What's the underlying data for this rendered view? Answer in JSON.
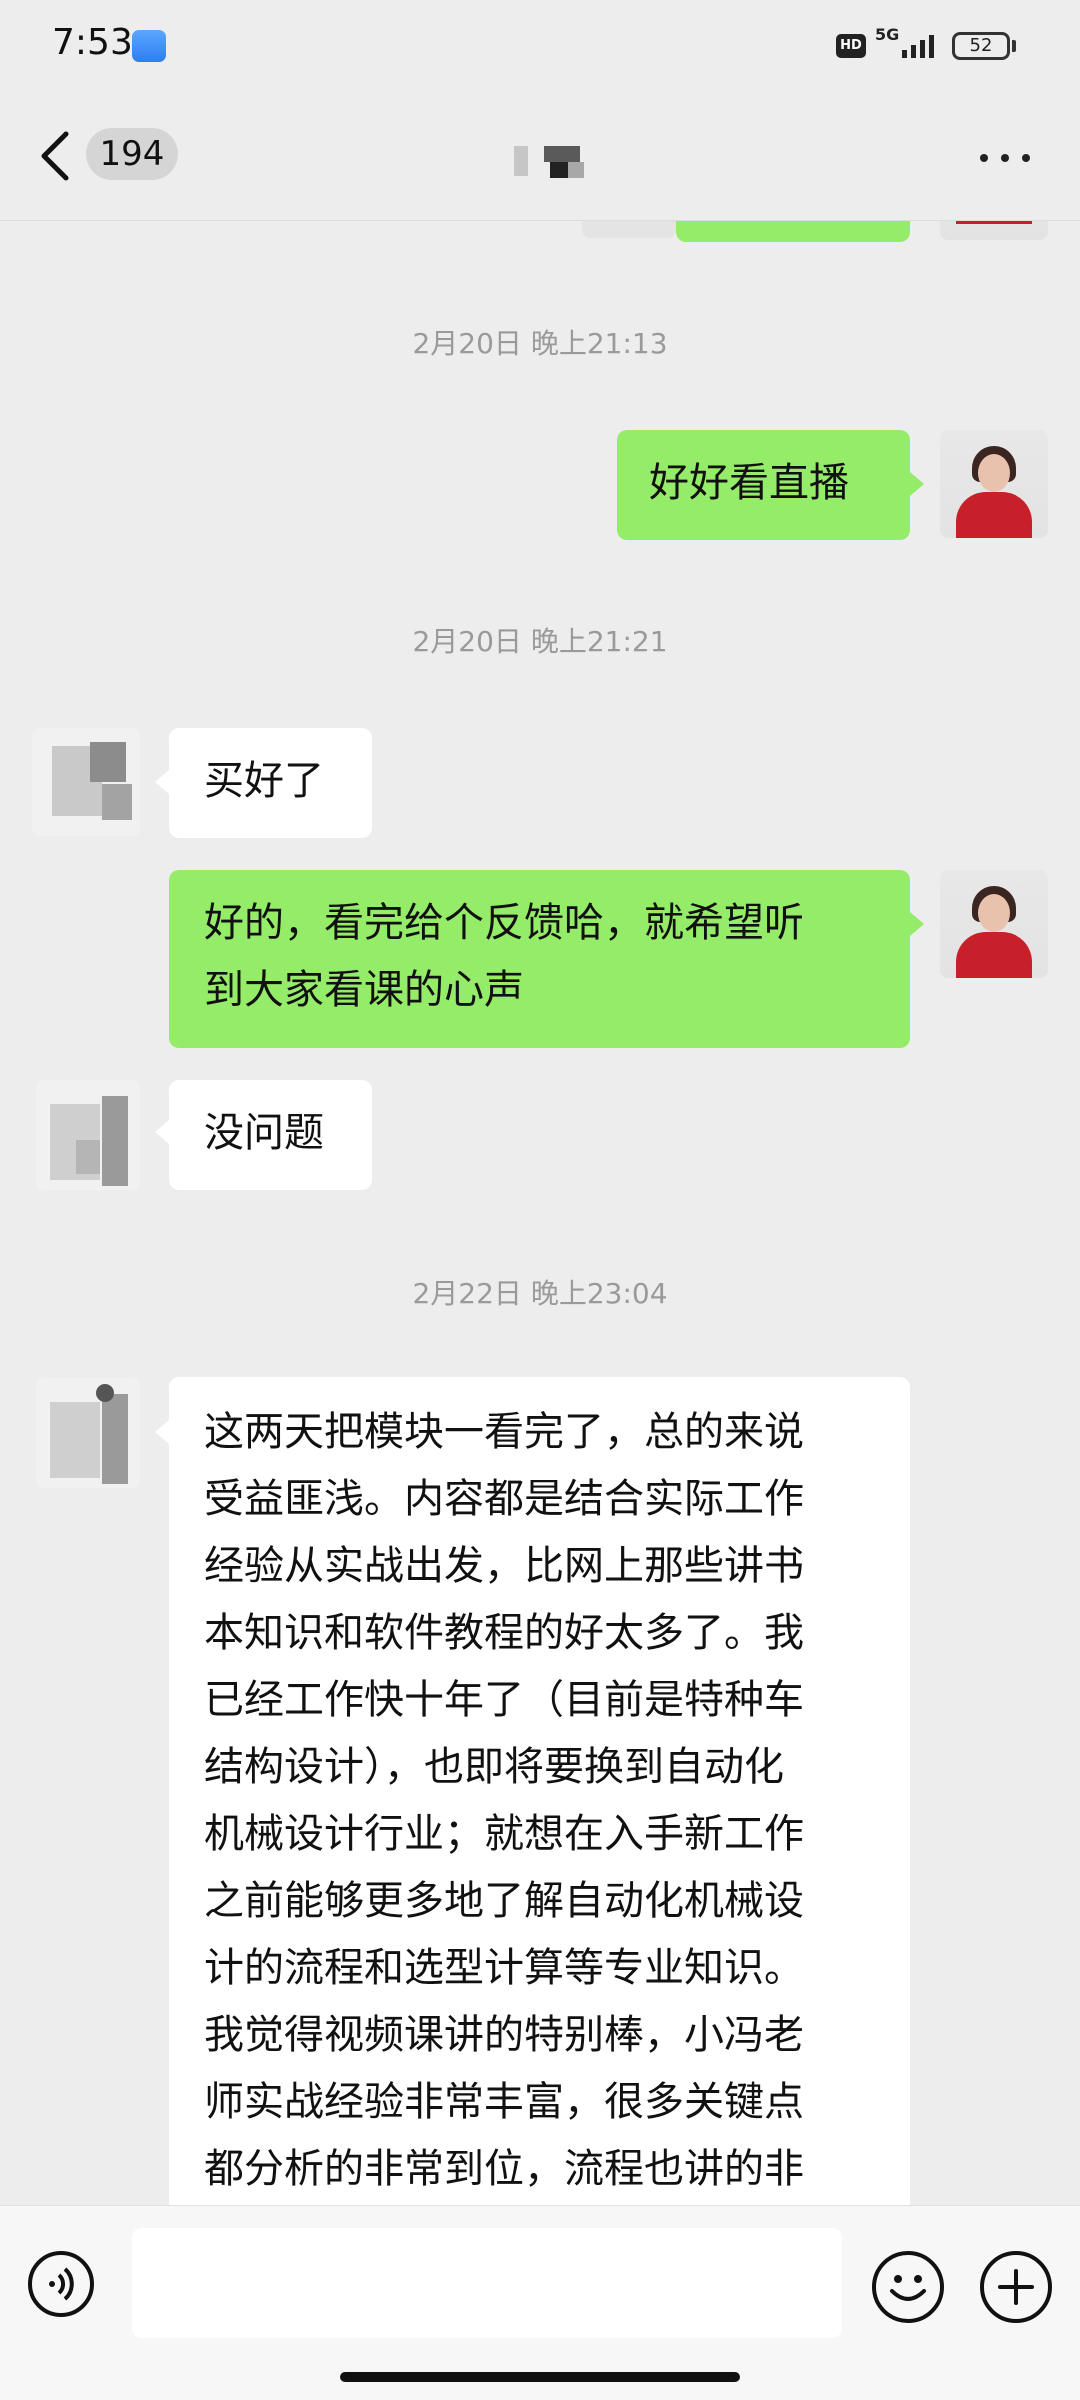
{
  "status_bar": {
    "time": "7:53",
    "network": "5G",
    "hd": "HD",
    "battery": "52"
  },
  "nav": {
    "unread_count": "194"
  },
  "messages": {
    "ts1": "2月20日 晚上21:13",
    "m1": "好好看直播",
    "ts2": "2月20日 晚上21:21",
    "m2": "买好了",
    "m3_line1": "好的，看完给个反馈哈，就希望听",
    "m3_line2": "到大家看课的心声",
    "m4": "没问题",
    "ts3": "2月22日 晚上23:04",
    "m5_lines": [
      "这两天把模块一看完了，总的来说",
      "受益匪浅。内容都是结合实际工作",
      "经验从实战出发，比网上那些讲书",
      "本知识和软件教程的好太多了。我",
      "已经工作快十年了（目前是特种车",
      "结构设计），也即将要换到自动化",
      "机械设计行业；就想在入手新工作",
      "之前能够更多地了解自动化机械设",
      "计的流程和选型计算等专业知识。",
      "我觉得视频课讲的特别棒，小冯老",
      "师实战经验非常丰富，很多关键点",
      "都分析的非常到位，流程也讲的非"
    ]
  },
  "colors": {
    "outgoing_bubble": "#95ec69",
    "incoming_bubble": "#ffffff",
    "background": "#ededed"
  },
  "icons": {
    "back": "chevron-left-icon",
    "more": "more-dots-icon",
    "voice": "voice-icon",
    "emoji": "emoji-icon",
    "plus": "plus-icon"
  }
}
